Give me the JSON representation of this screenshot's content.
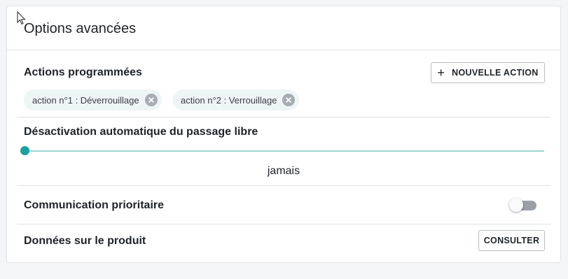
{
  "card": {
    "title": "Options avancées"
  },
  "scheduled_actions": {
    "label": "Actions programmées",
    "new_action_label": "NOUVELLE ACTION",
    "chips": [
      {
        "label": "action n°1 : Déverrouillage"
      },
      {
        "label": "action n°2 : Verrouillage"
      }
    ]
  },
  "auto_deactivation": {
    "label": "Désactivation automatique du passage libre",
    "value_text": "jamais",
    "slider_position": 0
  },
  "priority_communication": {
    "label": "Communication prioritaire",
    "enabled": false
  },
  "product_data": {
    "label": "Données sur le produit",
    "consult_label": "CONSULTER"
  },
  "icons": {
    "plus": "plus-icon",
    "chip_remove": "close-circle-icon",
    "cursor": "mouse-pointer-icon"
  },
  "colors": {
    "accent": "#17a2a0",
    "accent_light": "#9ad6d4",
    "chip_bg": "#eef5f5",
    "border": "#dfe2e6"
  }
}
